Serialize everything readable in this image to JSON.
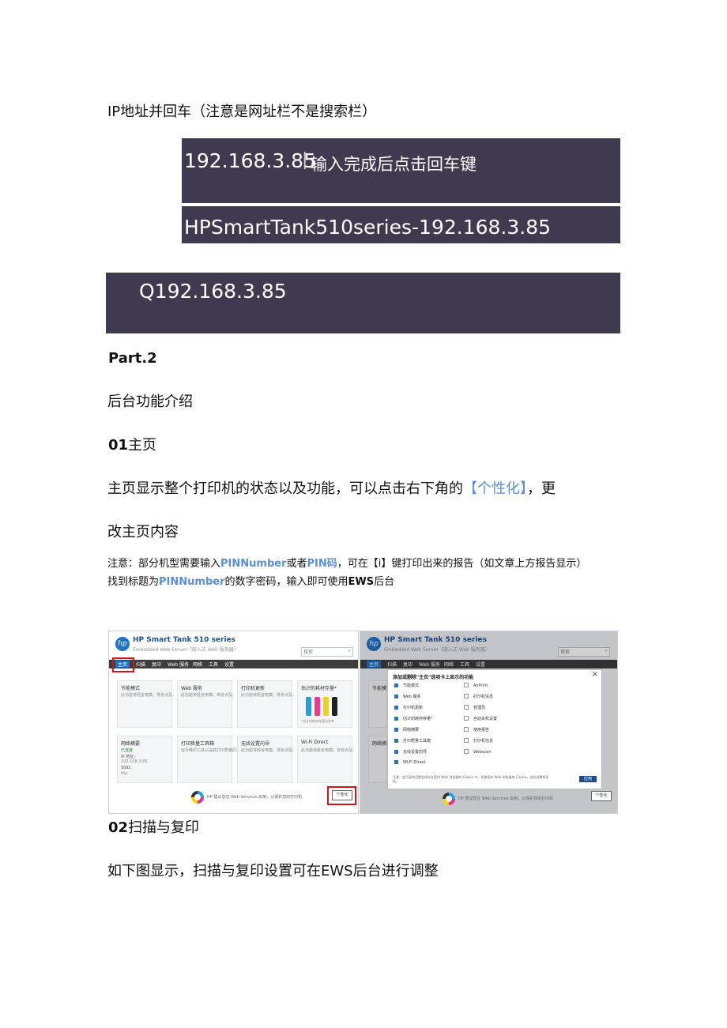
{
  "intro_line": "IP地址并回车（注意是网址栏不是搜索栏）",
  "bars": {
    "bar1_ip": "192.168.3.85",
    "bar1_sep": "|",
    "bar1_hint": "输入完成后点击回车键",
    "bar2_text": "HPSmartTank510series-192.168.3.85",
    "bar3_text": "Q192.168.3.85"
  },
  "part_heading": "Part.2",
  "section_title": "后台功能介绍",
  "sub1": {
    "num": "01",
    "title": "主页"
  },
  "paragraph1": {
    "before": "主页显示整个打印机的状态以及功能，可以点击右下角的",
    "highlight": "【个性化】",
    "after": "，更",
    "line2": "改主页内容"
  },
  "note": {
    "l1_a": "注意：部分机型需要输入",
    "l1_b": "PINNumber",
    "l1_c": "或者",
    "l1_d": "PIN码",
    "l1_e": "，可在【i】键打印出来的报告（如文章上方报告显示）",
    "l2_a": "找到标题为",
    "l2_b": "PINNumber",
    "l2_c": "的数字密码，输入即可使用",
    "l2_d": "EWS",
    "l2_e": "后台"
  },
  "ews": {
    "title": "HP Smart Tank 510 series",
    "subtitle": "Embedded Web Server（嵌入式 Web 服务器）",
    "search_placeholder": "搜索",
    "nav": [
      "主页",
      "扫描",
      "复印",
      "Web 服务",
      "网络",
      "工具",
      "设置"
    ],
    "cards_row1": [
      "节能模式",
      "Web 服务",
      "打印机更新",
      "估计的耗材存量*"
    ],
    "cards_row2": [
      "网络摘要",
      "打印质量工具箱",
      "无线设置向导",
      "Wi-Fi Direct"
    ],
    "card_text": [
      "此功能将经省电模，将省点及。",
      "此功能将经省电模，将省点及。",
      "此功能将经省电模，将省点及。"
    ],
    "ink_note": "*估计的耗材存量为参考",
    "network_lines": [
      "已连接",
      "IP 地址：",
      "192.168.3.85",
      "SSID:",
      "Hix"
    ],
    "toolbox_text": "运行维护工具以提高打印质量的设置。",
    "wifi_text": "此功能将经省电模，将省点及。",
    "footer_text": "HP 建议您在 Web Services 启用，以保护您的打印机",
    "personalize_label": "个性化",
    "dialog_title": "添加或删除\"主页\"选项卡上显示的功能",
    "dialog_left": [
      "节能模式",
      "Web 服务",
      "打印机更新",
      "估计的耗材存量*",
      "网络摘要",
      "打印质量工具箱",
      "无线设置向导",
      "Wi-Fi Direct"
    ],
    "dialog_right": [
      "AirPrint",
      "打印机信息",
      "管理员",
      "自动关机设置",
      "使用报告",
      "打印机信息",
      "Webscan"
    ],
    "dialog_footer": "注意：此页面的设置会保存在您的 Web 浏览器的 Cookie 中。如果您的 Web 浏览器的 Cookie，这些设置将丢失。",
    "save_label": "应用"
  },
  "sub2": {
    "num": "02",
    "title": "扫描与复印"
  },
  "paragraph2": "如下图显示，扫描与复印设置可在EWS后台进行调整",
  "colors": {
    "bar_bg": "#3f3a4f",
    "link_blue": "#5b8fd6",
    "hp_blue": "#1f73c9",
    "highlight_red": "#d4141b"
  }
}
